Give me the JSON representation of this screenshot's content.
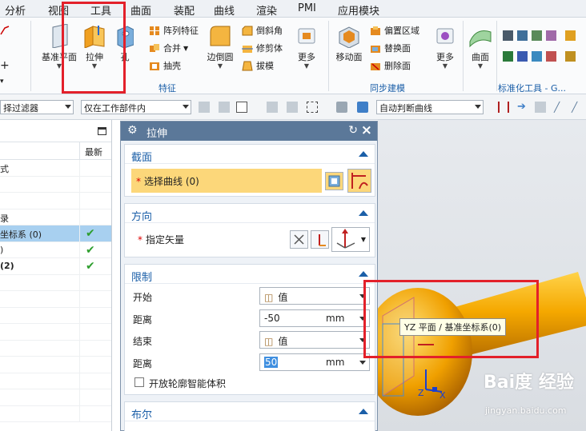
{
  "menu": [
    "分析",
    "视图",
    "工具",
    "曲面",
    "装配",
    "曲线",
    "渲染",
    "PMI",
    "应用模块"
  ],
  "ribbon": {
    "datum_label": "基准平面",
    "extrude_label": "拉伸",
    "hole_label": "孔",
    "pattern_feature": "阵列特征",
    "unite": "合并",
    "shell": "抽壳",
    "edge_blend": "边倒圆",
    "chamfer": "倒斜角",
    "trim_body": "修剪体",
    "draft": "拔模",
    "more1": "更多",
    "feature_group": "特征",
    "move_face": "移动面",
    "offset_region": "偏置区域",
    "replace_face": "替换面",
    "delete_face": "删除面",
    "more2": "更多",
    "sync_group": "同步建模",
    "surface": "曲面",
    "std_tools_group": "标准化工具 - G..."
  },
  "toolbar": {
    "filter": "择过滤器",
    "scope": "仅在工作部件内",
    "curve_rule": "自动判断曲线"
  },
  "navigator": {
    "col_latest": "最新",
    "rows": [
      {
        "text": "式",
        "check": false,
        "sel": false
      },
      {
        "text": "",
        "check": false,
        "sel": false
      },
      {
        "text": "",
        "check": false,
        "sel": false
      },
      {
        "text": "录",
        "check": false,
        "sel": false
      },
      {
        "text": "坐标系 (0)",
        "check": true,
        "sel": true
      },
      {
        "text": ")",
        "check": true,
        "sel": false
      },
      {
        "text": "(2)",
        "check": true,
        "sel": false
      },
      {
        "text": "",
        "check": false,
        "sel": false
      },
      {
        "text": "",
        "check": false,
        "sel": false
      },
      {
        "text": "",
        "check": false,
        "sel": false
      },
      {
        "text": "",
        "check": false,
        "sel": false
      },
      {
        "text": "",
        "check": false,
        "sel": false
      },
      {
        "text": "",
        "check": false,
        "sel": false
      },
      {
        "text": "",
        "check": false,
        "sel": false
      },
      {
        "text": "",
        "check": false,
        "sel": false
      },
      {
        "text": "",
        "check": false,
        "sel": false
      }
    ]
  },
  "dialog": {
    "title": "拉伸",
    "section": {
      "title": "截面",
      "select_curve": "选择曲线 (0)"
    },
    "direction": {
      "title": "方向",
      "specify_vector": "指定矢量"
    },
    "limits": {
      "title": "限制",
      "start_label": "开始",
      "start_value": "值",
      "distance_label": "距离",
      "start_distance": "-50",
      "unit": "mm",
      "end_label": "结束",
      "end_value": "值",
      "end_distance": "50",
      "open_profile": "开放轮廓智能体积"
    },
    "boolean": {
      "title": "布尔"
    }
  },
  "viewport": {
    "tooltip": "YZ 平面 / 基准坐标系(0)",
    "axis_z": "Z",
    "axis_x": "X"
  },
  "watermark": {
    "main": "Bai度 经验",
    "sub": "jingyan.baidu.com"
  },
  "colors": {
    "accent": "#1b5fa8",
    "highlight": "#fcd77a",
    "part": "#f5a800",
    "annotation": "#e3202a"
  }
}
